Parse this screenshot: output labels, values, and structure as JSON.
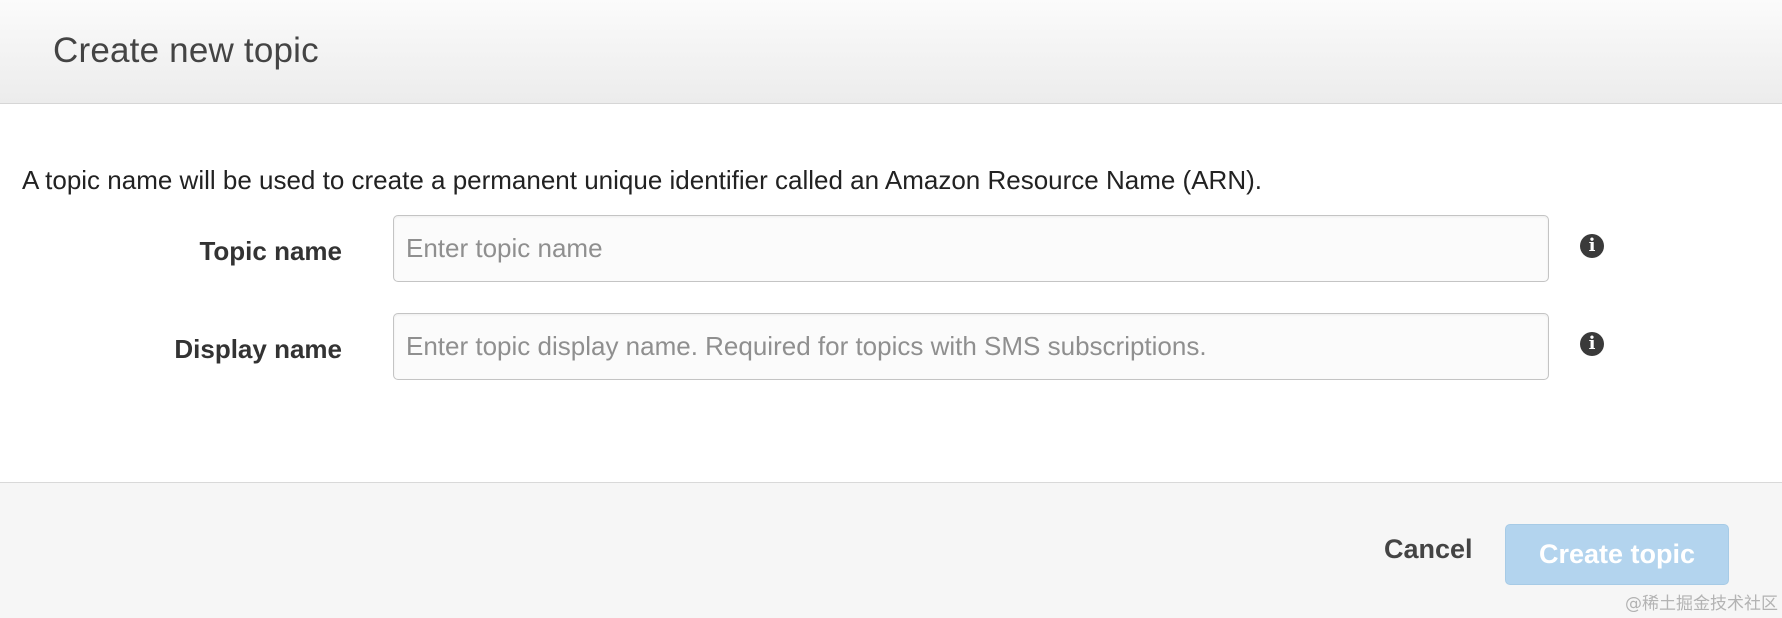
{
  "dialog": {
    "title": "Create new topic",
    "description": "A topic name will be used to create a permanent unique identifier called an Amazon Resource Name (ARN)."
  },
  "fields": {
    "topic_name": {
      "label": "Topic name",
      "placeholder": "Enter topic name",
      "value": "",
      "info_icon": "info-circle-icon"
    },
    "display_name": {
      "label": "Display name",
      "placeholder": "Enter topic display name. Required for topics with SMS subscriptions.",
      "value": "",
      "info_icon": "info-circle-icon"
    }
  },
  "footer": {
    "cancel_label": "Cancel",
    "create_label": "Create topic",
    "create_disabled": true
  },
  "watermark": "@稀土掘金技术社区",
  "colors": {
    "create_button_disabled": "#b3d4ee",
    "header_gradient_top": "#fbfbfb",
    "header_gradient_bottom": "#ececec",
    "footer_bg": "#f6f6f6"
  }
}
